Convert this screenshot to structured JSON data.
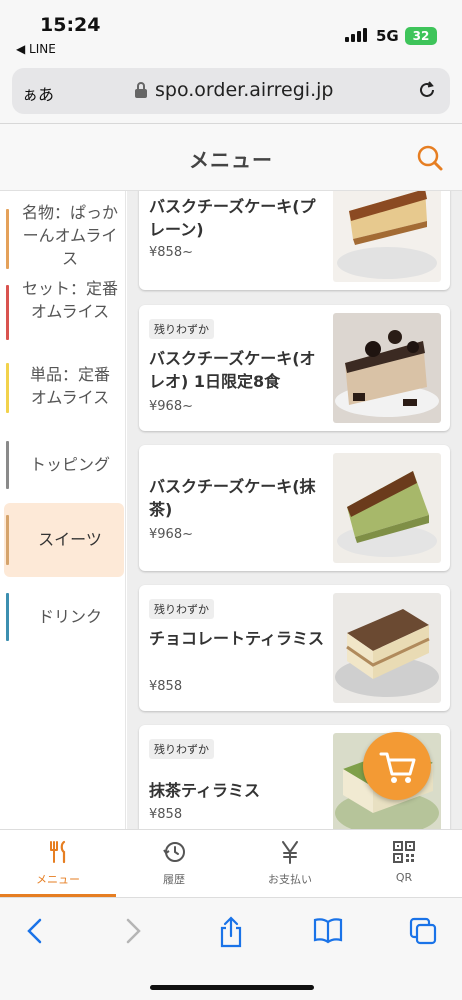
{
  "status": {
    "time": "15:24",
    "back_app": "◀ LINE",
    "network": "5G",
    "battery": "32"
  },
  "browser": {
    "aa": "ぁあ",
    "url": "spo.order.airregi.jp"
  },
  "header": {
    "title": "メニュー"
  },
  "categories": [
    {
      "label": "名物：ぱっかーんオムライス",
      "color": "#e4a15a"
    },
    {
      "label": "セット：定番オムライス",
      "color": "#d9534f"
    },
    {
      "label": "単品：定番オムライス",
      "color": "#f2d24b"
    },
    {
      "label": "トッピング",
      "color": "#8a8a8a"
    },
    {
      "label": "スイーツ",
      "color": "#d5a36b",
      "active": true
    },
    {
      "label": "ドリンク",
      "color": "#3c8fb0"
    }
  ],
  "products": [
    {
      "name": "バスクチーズケーキ(プレーン)",
      "price": "¥858~",
      "badge": ""
    },
    {
      "name": "バスクチーズケーキ(オレオ) 1日限定8食",
      "price": "¥968~",
      "badge": "残りわずか"
    },
    {
      "name": "バスクチーズケーキ(抹茶)",
      "price": "¥968~",
      "badge": ""
    },
    {
      "name": "チョコレートティラミス",
      "price": "¥858",
      "badge": "残りわずか"
    },
    {
      "name": "抹茶ティラミス",
      "price": "¥858",
      "badge": "残りわずか"
    }
  ],
  "tabs": [
    {
      "label": "メニュー",
      "icon": "fork-knife-icon",
      "active": true
    },
    {
      "label": "履歴",
      "icon": "history-icon"
    },
    {
      "label": "お支払い",
      "icon": "yen-icon"
    },
    {
      "label": "QR",
      "icon": "qr-code-icon"
    }
  ],
  "colors": {
    "accent": "#e67e22",
    "cart": "#f39a34",
    "ios_blue": "#1a73e8"
  }
}
